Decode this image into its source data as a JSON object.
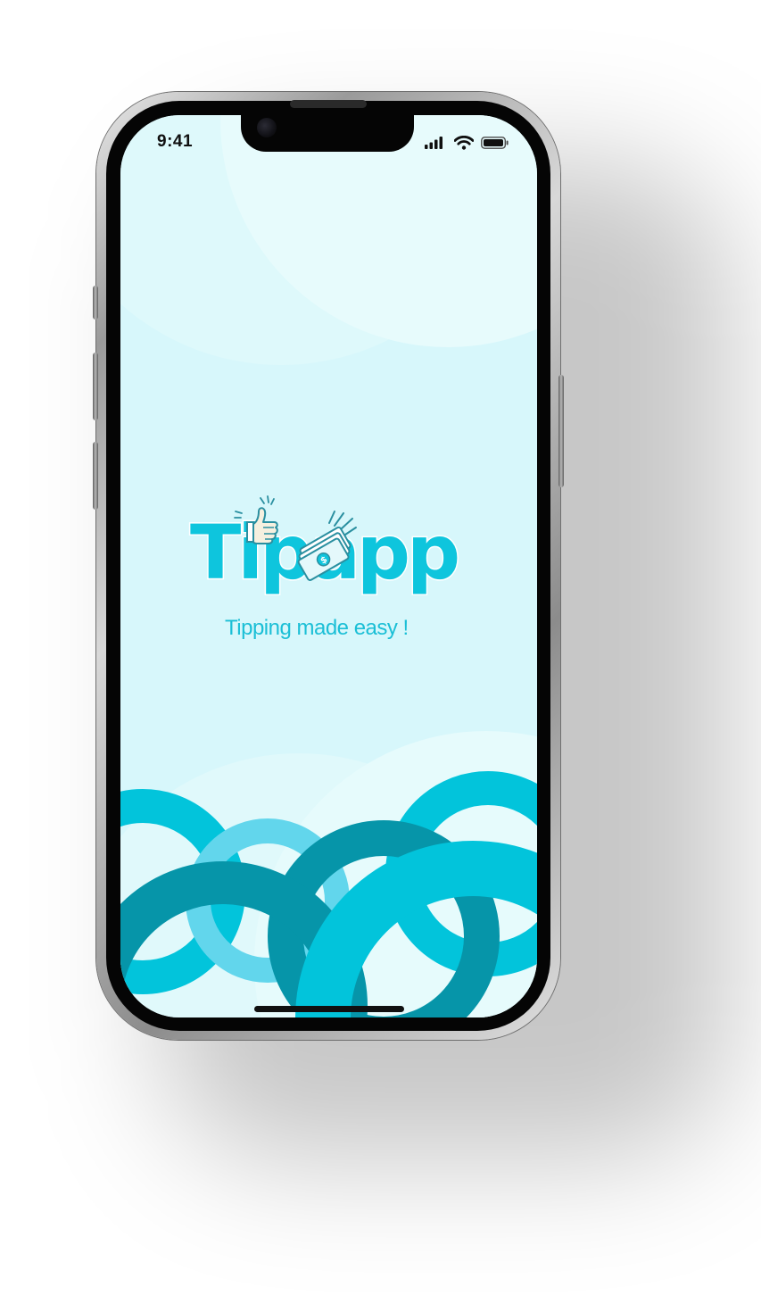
{
  "status_bar": {
    "time": "9:41",
    "icons": [
      "cellular-signal-icon",
      "wifi-icon",
      "battery-icon"
    ]
  },
  "splash": {
    "logo_text": "Tipapp",
    "tagline": "Tipping made easy !"
  },
  "colors": {
    "background": "#d7f7fb",
    "accent": "#0ec5dd",
    "teal_dark": "#0695a9",
    "cyan": "#02c4db",
    "light_cyan": "#62d6ec"
  }
}
